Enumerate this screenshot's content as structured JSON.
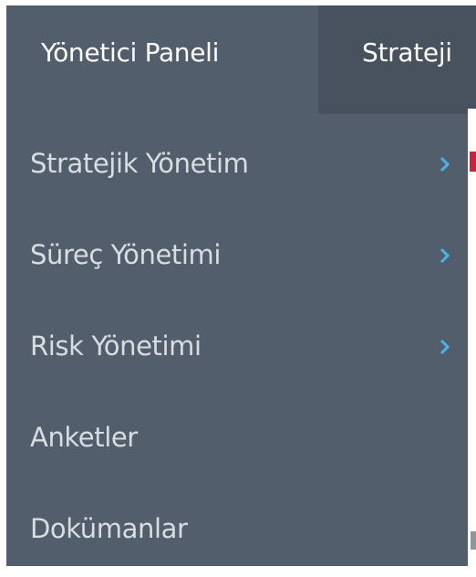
{
  "sidebar": {
    "title": "Yönetici Paneli",
    "items": [
      {
        "label": "Stratejik Yönetim",
        "has_submenu": true,
        "icon": "chevron-right-icon"
      },
      {
        "label": "Süreç Yönetimi",
        "has_submenu": true,
        "icon": "chevron-right-icon"
      },
      {
        "label": "Risk Yönetimi",
        "has_submenu": true,
        "icon": "chevron-right-icon"
      },
      {
        "label": "Anketler",
        "has_submenu": false
      },
      {
        "label": "Dokümanlar",
        "has_submenu": false
      }
    ]
  },
  "top_tab": {
    "label": "Strateji"
  },
  "colors": {
    "sidebar_bg": "#525e6b",
    "active_tab_bg": "#48525e",
    "menu_text": "#d8dde2",
    "title_text": "#ffffff",
    "chevron": "#4bb1e6",
    "accent_red": "#c8243f"
  }
}
